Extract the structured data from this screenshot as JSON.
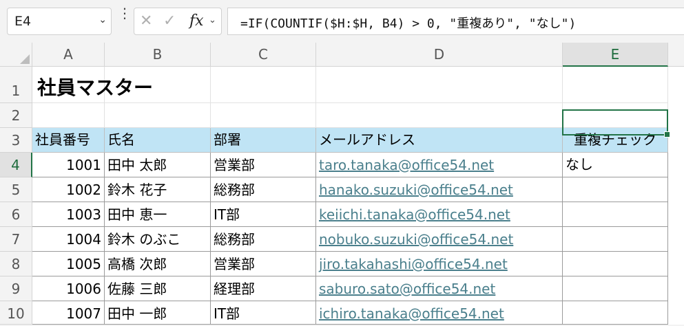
{
  "formula_bar": {
    "name_box": "E4",
    "formula": "=IF(COUNTIF($H:$H, B4) > 0, \"重複あり\", \"なし\")",
    "fx_label": "fx"
  },
  "columns": [
    "A",
    "B",
    "C",
    "D",
    "E"
  ],
  "selected_column": "E",
  "rows": [
    "1",
    "2",
    "3",
    "4",
    "5",
    "6",
    "7",
    "8",
    "9",
    "10"
  ],
  "selected_row": "4",
  "sheet_title": "社員マスター",
  "table": {
    "headers": [
      "社員番号",
      "氏名",
      "部署",
      "メールアドレス",
      "重複チェック"
    ],
    "records": [
      {
        "id": "1001",
        "name": "田中 太郎",
        "dept": "営業部",
        "email": "taro.tanaka@office54.net",
        "check": "なし"
      },
      {
        "id": "1002",
        "name": "鈴木 花子",
        "dept": "総務部",
        "email": "hanako.suzuki@office54.net",
        "check": ""
      },
      {
        "id": "1003",
        "name": "田中 恵一",
        "dept": "IT部",
        "email": "keiichi.tanaka@office54.net",
        "check": ""
      },
      {
        "id": "1004",
        "name": "鈴木 のぶこ",
        "dept": "総務部",
        "email": "nobuko.suzuki@office54.net",
        "check": ""
      },
      {
        "id": "1005",
        "name": "高橋 次郎",
        "dept": "営業部",
        "email": "jiro.takahashi@office54.net",
        "check": ""
      },
      {
        "id": "1006",
        "name": "佐藤 三郎",
        "dept": "経理部",
        "email": "saburo.sato@office54.net",
        "check": ""
      },
      {
        "id": "1007",
        "name": "田中 一郎",
        "dept": "IT部",
        "email": "ichiro.tanaka@office54.net",
        "check": ""
      }
    ]
  },
  "colors": {
    "accent": "#217346",
    "header_fill": "#c0e4f5",
    "link": "#4a7f8c"
  }
}
